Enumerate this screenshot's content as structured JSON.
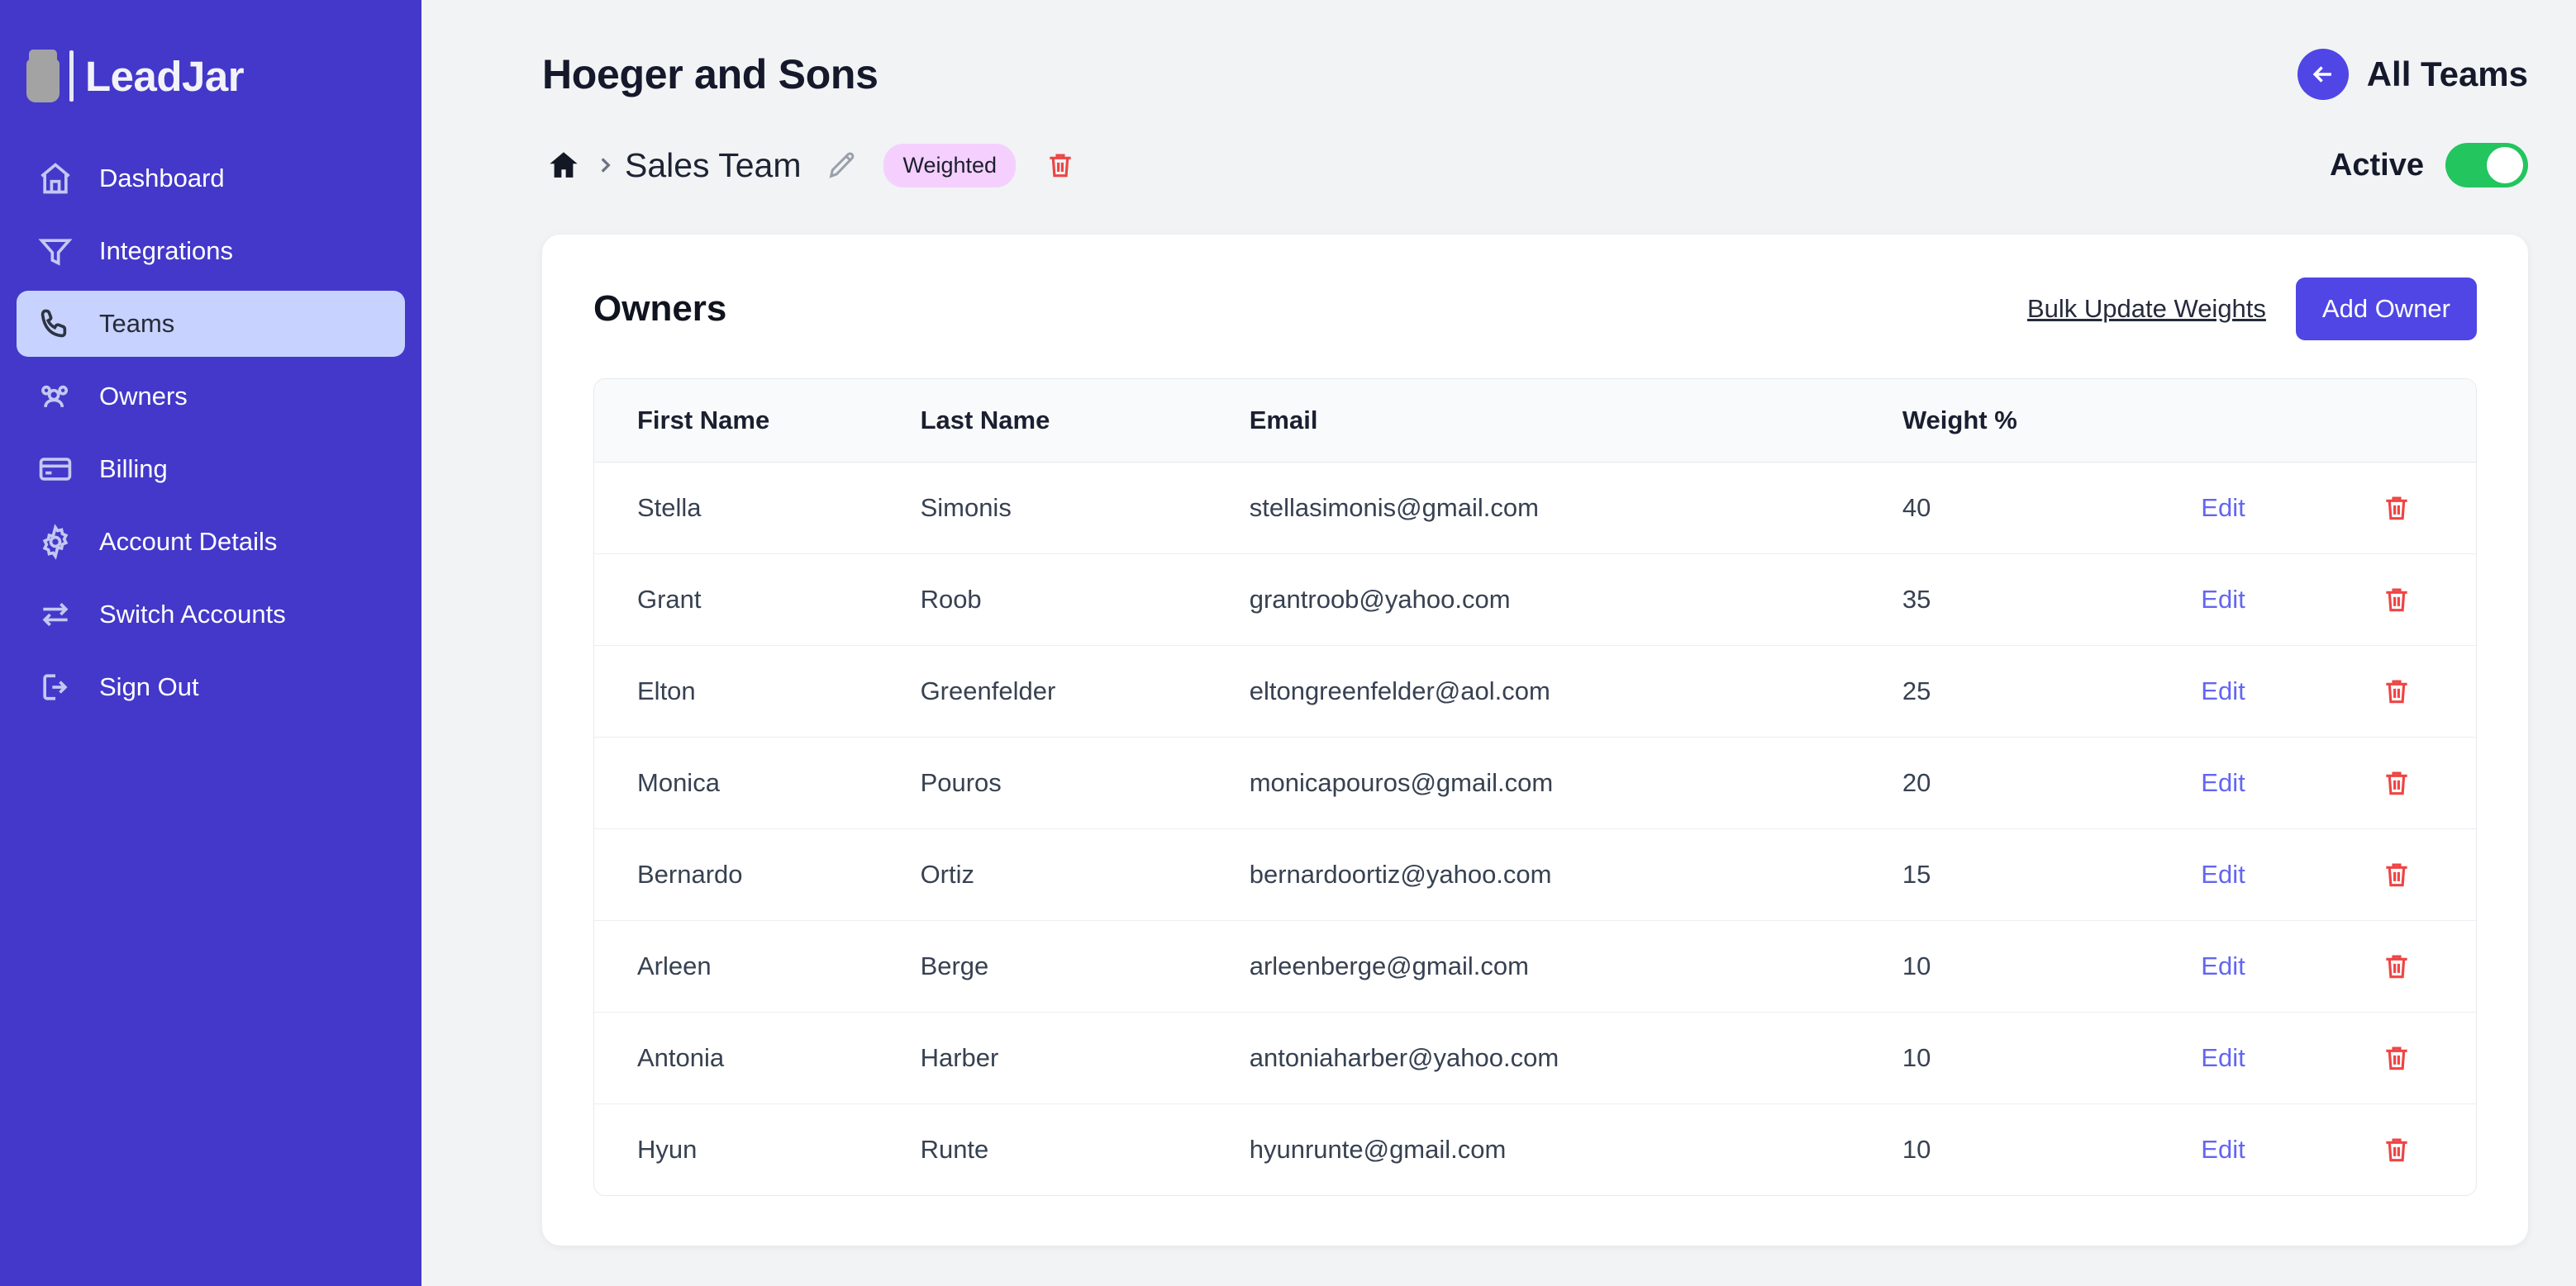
{
  "brand": {
    "name": "LeadJar",
    "logo_icon": "jar-icon"
  },
  "sidebar": {
    "items": [
      {
        "label": "Dashboard",
        "icon": "home-icon",
        "active": false
      },
      {
        "label": "Integrations",
        "icon": "funnel-icon",
        "active": false
      },
      {
        "label": "Teams",
        "icon": "phone-icon",
        "active": true
      },
      {
        "label": "Owners",
        "icon": "users-icon",
        "active": false
      },
      {
        "label": "Billing",
        "icon": "credit-card-icon",
        "active": false
      },
      {
        "label": "Account Details",
        "icon": "gear-icon",
        "active": false
      },
      {
        "label": "Switch Accounts",
        "icon": "swap-arrows-icon",
        "active": false
      },
      {
        "label": "Sign Out",
        "icon": "logout-icon",
        "active": false
      }
    ]
  },
  "header": {
    "title": "Hoeger and Sons",
    "all_teams_label": "All Teams",
    "back_icon": "arrow-left-icon"
  },
  "breadcrumb": {
    "home_icon": "home-filled-icon",
    "separator_icon": "chevron-right-icon",
    "team_name": "Sales Team",
    "edit_icon": "pencil-icon",
    "badge": "Weighted",
    "delete_icon": "trash-icon"
  },
  "status": {
    "label": "Active",
    "enabled": true,
    "on_color": "#22c55e"
  },
  "card": {
    "title": "Owners",
    "bulk_update_label": "Bulk Update Weights",
    "add_owner_label": "Add Owner"
  },
  "table": {
    "columns": [
      "First Name",
      "Last Name",
      "Email",
      "Weight %"
    ],
    "row_action_label": "Edit",
    "row_delete_icon": "trash-icon",
    "rows": [
      {
        "first": "Stella",
        "last": "Simonis",
        "email": "stellasimonis@gmail.com",
        "weight": "40"
      },
      {
        "first": "Grant",
        "last": "Roob",
        "email": "grantroob@yahoo.com",
        "weight": "35"
      },
      {
        "first": "Elton",
        "last": "Greenfelder",
        "email": "eltongreenfelder@aol.com",
        "weight": "25"
      },
      {
        "first": "Monica",
        "last": "Pouros",
        "email": "monicapouros@gmail.com",
        "weight": "20"
      },
      {
        "first": "Bernardo",
        "last": "Ortiz",
        "email": "bernardoortiz@yahoo.com",
        "weight": "15"
      },
      {
        "first": "Arleen",
        "last": "Berge",
        "email": "arleenberge@gmail.com",
        "weight": "10"
      },
      {
        "first": "Antonia",
        "last": "Harber",
        "email": "antoniaharber@yahoo.com",
        "weight": "10"
      },
      {
        "first": "Hyun",
        "last": "Runte",
        "email": "hyunrunte@gmail.com",
        "weight": "10"
      }
    ]
  },
  "colors": {
    "sidebar_bg": "#4338ca",
    "sidebar_active_bg": "#c7d2fe",
    "accent": "#4f46e5",
    "link": "#6366f1",
    "danger": "#ef4444",
    "badge_bg": "#f5d0fe",
    "page_bg": "#f1f3f5"
  }
}
